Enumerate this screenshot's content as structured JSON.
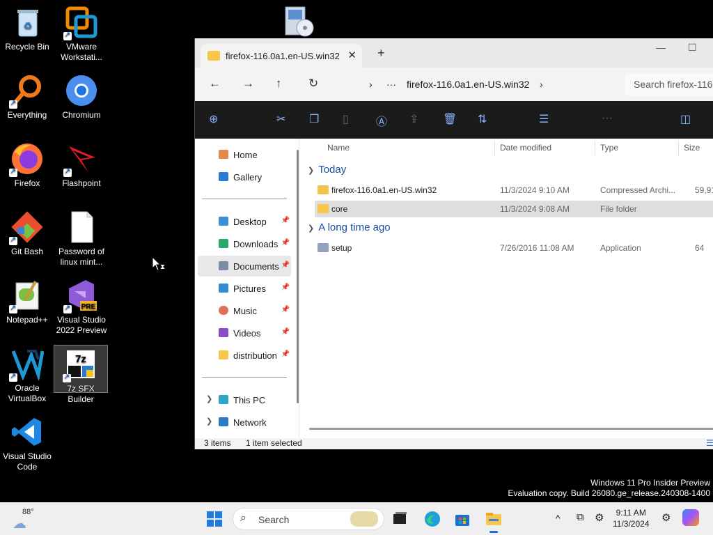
{
  "desktop": {
    "icons": [
      {
        "label": "Recycle Bin"
      },
      {
        "label": "VMware Workstati..."
      },
      {
        "label": "Everything"
      },
      {
        "label": "Chromium"
      },
      {
        "label": "Firefox"
      },
      {
        "label": "Flashpoint"
      },
      {
        "label": "Git Bash"
      },
      {
        "label": "Password of linux mint..."
      },
      {
        "label": "Notepad++"
      },
      {
        "label": "Visual Studio 2022 Preview"
      },
      {
        "label": "Oracle VirtualBox"
      },
      {
        "label": "7z SFX Builder"
      },
      {
        "label": "Visual Studio Code"
      }
    ],
    "badge_pre": "PRE",
    "sevenz_text": "7z"
  },
  "explorer": {
    "tab_title": "firefox-116.0a1.en-US.win32",
    "tab_close": "✕",
    "new_tab": "+",
    "minimize": "—",
    "maximize": "☐",
    "address": {
      "ellipsis": "···",
      "crumb": "firefox-116.0a1.en-US.win32",
      "chevron": "›"
    },
    "search_placeholder": "Search firefox-116...",
    "nav": {
      "home": "Home",
      "gallery": "Gallery",
      "desktop": "Desktop",
      "downloads": "Downloads",
      "documents": "Documents",
      "pictures": "Pictures",
      "music": "Music",
      "videos": "Videos",
      "distribution": "distribution",
      "this_pc": "This PC",
      "network": "Network"
    },
    "columns": {
      "name": "Name",
      "date": "Date modified",
      "type": "Type",
      "size": "Size"
    },
    "groups": {
      "today": "Today",
      "long_ago": "A long time ago"
    },
    "rows": [
      {
        "name": "firefox-116.0a1.en-US.win32",
        "date": "11/3/2024 9:10 AM",
        "type": "Compressed Archi...",
        "size": "59,91"
      },
      {
        "name": "core",
        "date": "11/3/2024 9:08 AM",
        "type": "File folder",
        "size": ""
      },
      {
        "name": "setup",
        "date": "7/26/2016 11:08 AM",
        "type": "Application",
        "size": "64"
      }
    ],
    "status": {
      "items": "3 items",
      "selected": "1 item selected"
    }
  },
  "watermark": {
    "line1": "Windows 11 Pro Insider Preview",
    "line2": "Evaluation copy. Build 26080.ge_release.240308-1400"
  },
  "taskbar": {
    "weather_temp": "88°",
    "search_label": "Search",
    "time": "9:11 AM",
    "date": "11/3/2024",
    "tray_chevron": "^"
  }
}
